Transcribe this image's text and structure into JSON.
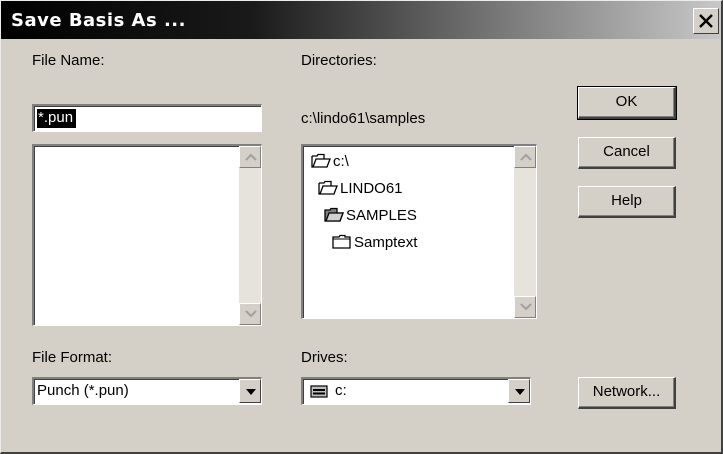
{
  "dialog": {
    "title": "Save Basis As ...",
    "close_icon": "close-icon"
  },
  "file_name": {
    "label": "File Name:",
    "value": "*.pun"
  },
  "directories": {
    "label": "Directories:",
    "current_path": "c:\\lindo61\\samples",
    "items": [
      {
        "label": "c:\\",
        "icon": "folder-open-icon"
      },
      {
        "label": "LINDO61",
        "icon": "folder-open-icon"
      },
      {
        "label": "SAMPLES",
        "icon": "folder-open-selected-icon"
      },
      {
        "label": "Samptext",
        "icon": "folder-closed-icon"
      }
    ]
  },
  "file_format": {
    "label": "File Format:",
    "selected": "Punch (*.pun)"
  },
  "drives": {
    "label": "Drives:",
    "selected": "c:",
    "icon": "drive-icon"
  },
  "buttons": {
    "ok": "OK",
    "cancel": "Cancel",
    "help": "Help",
    "network": "Network..."
  }
}
